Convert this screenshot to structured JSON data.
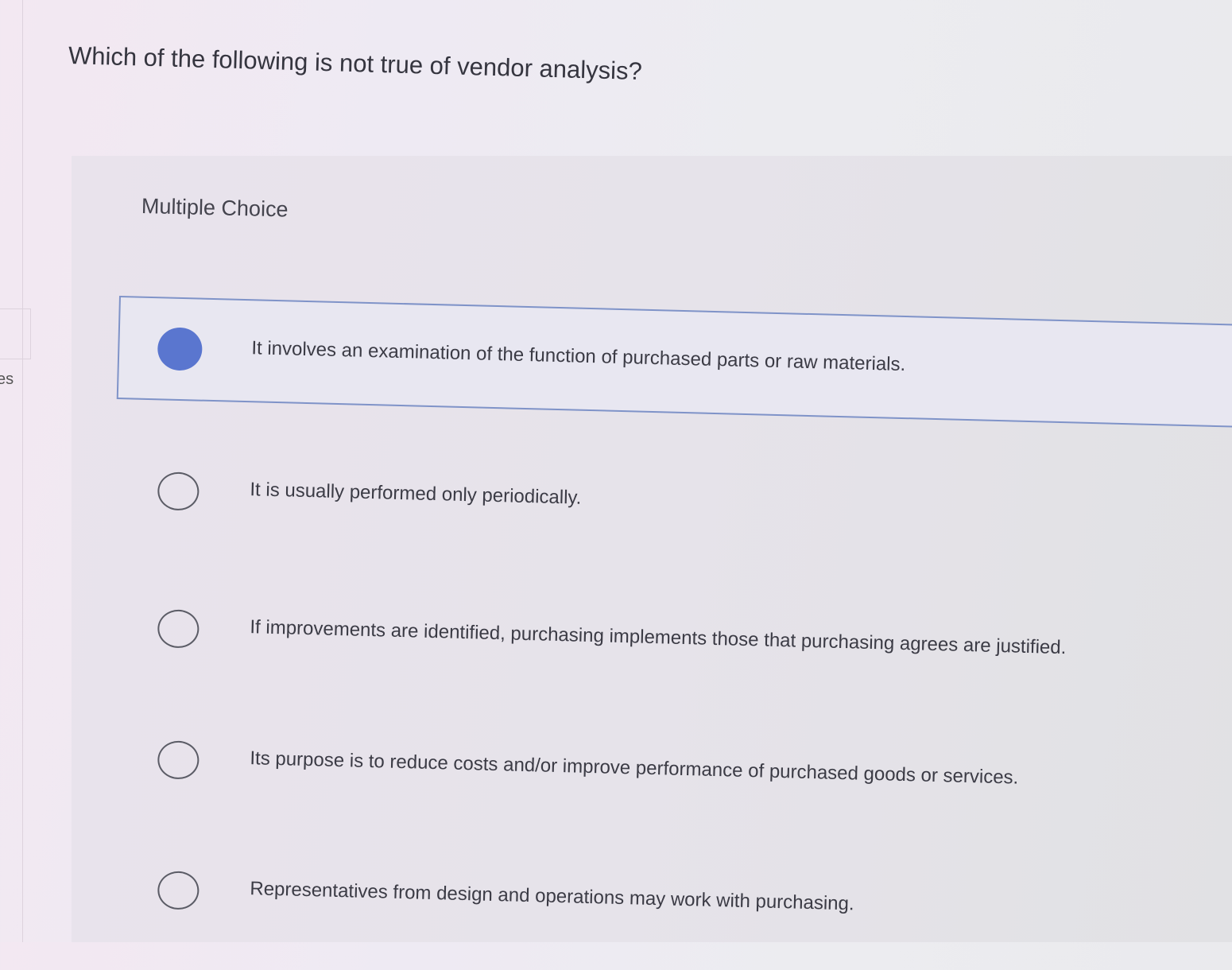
{
  "edge": {
    "text": "es"
  },
  "question": {
    "text": "Which of the following is not true of vendor analysis?"
  },
  "section": {
    "label": "Multiple Choice"
  },
  "options": [
    {
      "text": "It involves an examination of the function of purchased parts or raw materials.",
      "selected": true
    },
    {
      "text": "It is usually performed only periodically.",
      "selected": false
    },
    {
      "text": "If improvements are identified, purchasing implements those that purchasing agrees are justified.",
      "selected": false
    },
    {
      "text": "Its purpose is to reduce costs and/or improve performance of purchased goods or services.",
      "selected": false
    },
    {
      "text": "Representatives from design and operations may work with purchasing.",
      "selected": false
    }
  ],
  "colors": {
    "selected_radio": "#5a76cf",
    "selected_border": "#7f93c8",
    "text": "#3b3b45"
  }
}
